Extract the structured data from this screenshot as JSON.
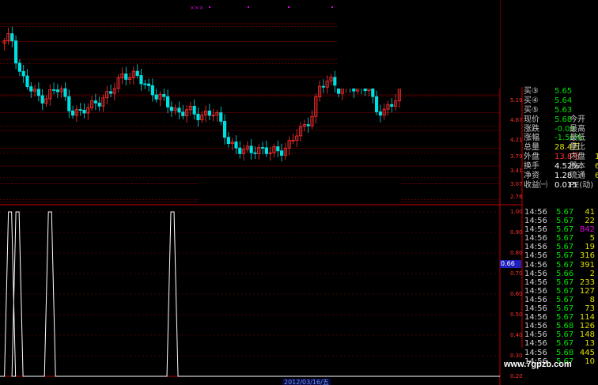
{
  "quote_panel": {
    "rows": [
      {
        "label": "买③",
        "value": "5.65"
      },
      {
        "label": "买④",
        "value": "5.64"
      },
      {
        "label": "买⑤",
        "value": "5.63"
      },
      {
        "label": "现价",
        "value": "5.68",
        "label2": "今开",
        "value2": ""
      },
      {
        "label": "涨跌",
        "value": "-0.09",
        "label2": "最高",
        "value2": ""
      },
      {
        "label": "涨幅",
        "value": "-1.56%",
        "label2": "最低",
        "value2": ""
      },
      {
        "label": "总量",
        "value": "28.4万",
        "label2": "量比",
        "value2": ""
      },
      {
        "label": "外盘",
        "value": "13.8万",
        "label2": "内盘",
        "value2": "1"
      },
      {
        "label": "换手",
        "value": "4.52%",
        "label2": "股本",
        "value2": "6"
      },
      {
        "label": "净资",
        "value": "1.28",
        "label2": "流通",
        "value2": "6"
      },
      {
        "label": "收益㈠",
        "value": "0.015",
        "label2": "PE(动)",
        "value2": ""
      }
    ]
  },
  "trades": [
    {
      "time": "14:56",
      "price": "5.67",
      "vol": "41",
      "purple": false
    },
    {
      "time": "14:56",
      "price": "5.67",
      "vol": "22",
      "purple": false
    },
    {
      "time": "14:56",
      "price": "5.67",
      "vol": "842",
      "purple": true
    },
    {
      "time": "14:56",
      "price": "5.67",
      "vol": "5",
      "purple": false
    },
    {
      "time": "14:56",
      "price": "5.67",
      "vol": "19",
      "purple": false
    },
    {
      "time": "14:56",
      "price": "5.67",
      "vol": "316",
      "purple": false
    },
    {
      "time": "14:56",
      "price": "5.67",
      "vol": "391",
      "purple": false
    },
    {
      "time": "14:56",
      "price": "5.66",
      "vol": "2",
      "purple": false
    },
    {
      "time": "14:56",
      "price": "5.67",
      "vol": "233",
      "purple": false
    },
    {
      "time": "14:56",
      "price": "5.67",
      "vol": "127",
      "purple": false
    },
    {
      "time": "14:56",
      "price": "5.67",
      "vol": "8",
      "purple": false
    },
    {
      "time": "14:56",
      "price": "5.67",
      "vol": "73",
      "purple": false
    },
    {
      "time": "14:56",
      "price": "5.67",
      "vol": "114",
      "purple": false
    },
    {
      "time": "14:56",
      "price": "5.68",
      "vol": "126",
      "purple": false
    },
    {
      "time": "14:56",
      "price": "5.67",
      "vol": "148",
      "purple": false
    },
    {
      "time": "14:56",
      "price": "5.67",
      "vol": "13",
      "purple": false
    },
    {
      "time": "14:56",
      "price": "5.68",
      "vol": "445",
      "purple": false
    },
    {
      "time": "14:56",
      "price": "5.67",
      "vol": "10",
      "purple": false
    }
  ],
  "price_axis": [
    "5.19",
    "4.67",
    "4.21",
    "3.79",
    "3.41",
    "3.07",
    "2.76"
  ],
  "indicator_axis": [
    "1.00",
    "0.90",
    "0.80",
    "0.70",
    "0.60",
    "0.50",
    "0.40",
    "0.30",
    "0.20"
  ],
  "indicator_badge": "0.66",
  "date_label": "2012/03/16/五",
  "watermark": "www.7gpzb.com",
  "top_marker": "×××",
  "colors": {
    "up": "#ff3030",
    "down": "#00e0e0",
    "grid": "#8a0000",
    "indicator_line": "#ffffff"
  },
  "chart_data": {
    "type": "candlestick",
    "close_path": [
      4.95,
      5.05,
      4.6,
      4.4,
      4.25,
      4.2,
      4.22,
      4.28,
      4.3,
      4.1,
      4.0,
      3.95,
      4.05,
      4.15,
      4.18,
      4.2,
      4.4,
      4.55,
      4.5,
      4.45,
      4.4,
      4.3,
      4.2,
      4.1,
      4.05,
      4.0,
      4.0,
      3.95,
      3.95,
      4.0,
      3.95,
      3.8,
      3.6,
      3.5,
      3.4,
      3.45,
      3.5,
      3.45,
      3.4,
      3.45,
      3.5,
      3.55,
      3.7,
      3.8,
      4.0,
      4.3,
      4.4,
      4.45,
      4.3,
      4.35,
      4.3,
      4.35,
      4.4,
      3.95,
      4.0,
      4.1,
      4.2,
      4.5,
      4.7,
      4.9,
      5.1,
      5.2,
      5.3,
      5.15,
      5.2,
      5.25,
      5.3,
      5.35,
      5.3,
      5.4,
      5.45
    ],
    "price_ticks": [
      5.19,
      4.67,
      4.21,
      3.79,
      3.41,
      3.07,
      2.76
    ],
    "indicator": {
      "pulses": [
        0.02,
        0.035,
        0.1,
        0.345
      ],
      "levels": [
        0,
        1
      ]
    }
  }
}
